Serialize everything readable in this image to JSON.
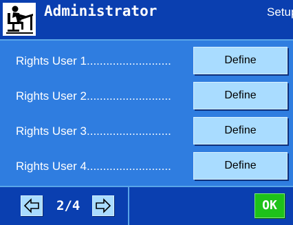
{
  "header": {
    "title": "Administrator",
    "mode": "Setup",
    "icon": "administrator-icon"
  },
  "rows": [
    {
      "label": "Rights User 1",
      "dots": "..........................",
      "button": "Define"
    },
    {
      "label": "Rights User 2",
      "dots": "..........................",
      "button": "Define"
    },
    {
      "label": "Rights User 3",
      "dots": "..........................",
      "button": "Define"
    },
    {
      "label": "Rights User 4",
      "dots": "..........................",
      "button": "Define"
    }
  ],
  "footer": {
    "page": "2/4",
    "prev_icon": "arrow-left-icon",
    "next_icon": "arrow-right-icon",
    "ok": "OK"
  },
  "colors": {
    "header_bg": "#0a3fb0",
    "content_bg": "#2f7de0",
    "button_bg": "#a9dcff",
    "ok_bg": "#1ec21a"
  }
}
